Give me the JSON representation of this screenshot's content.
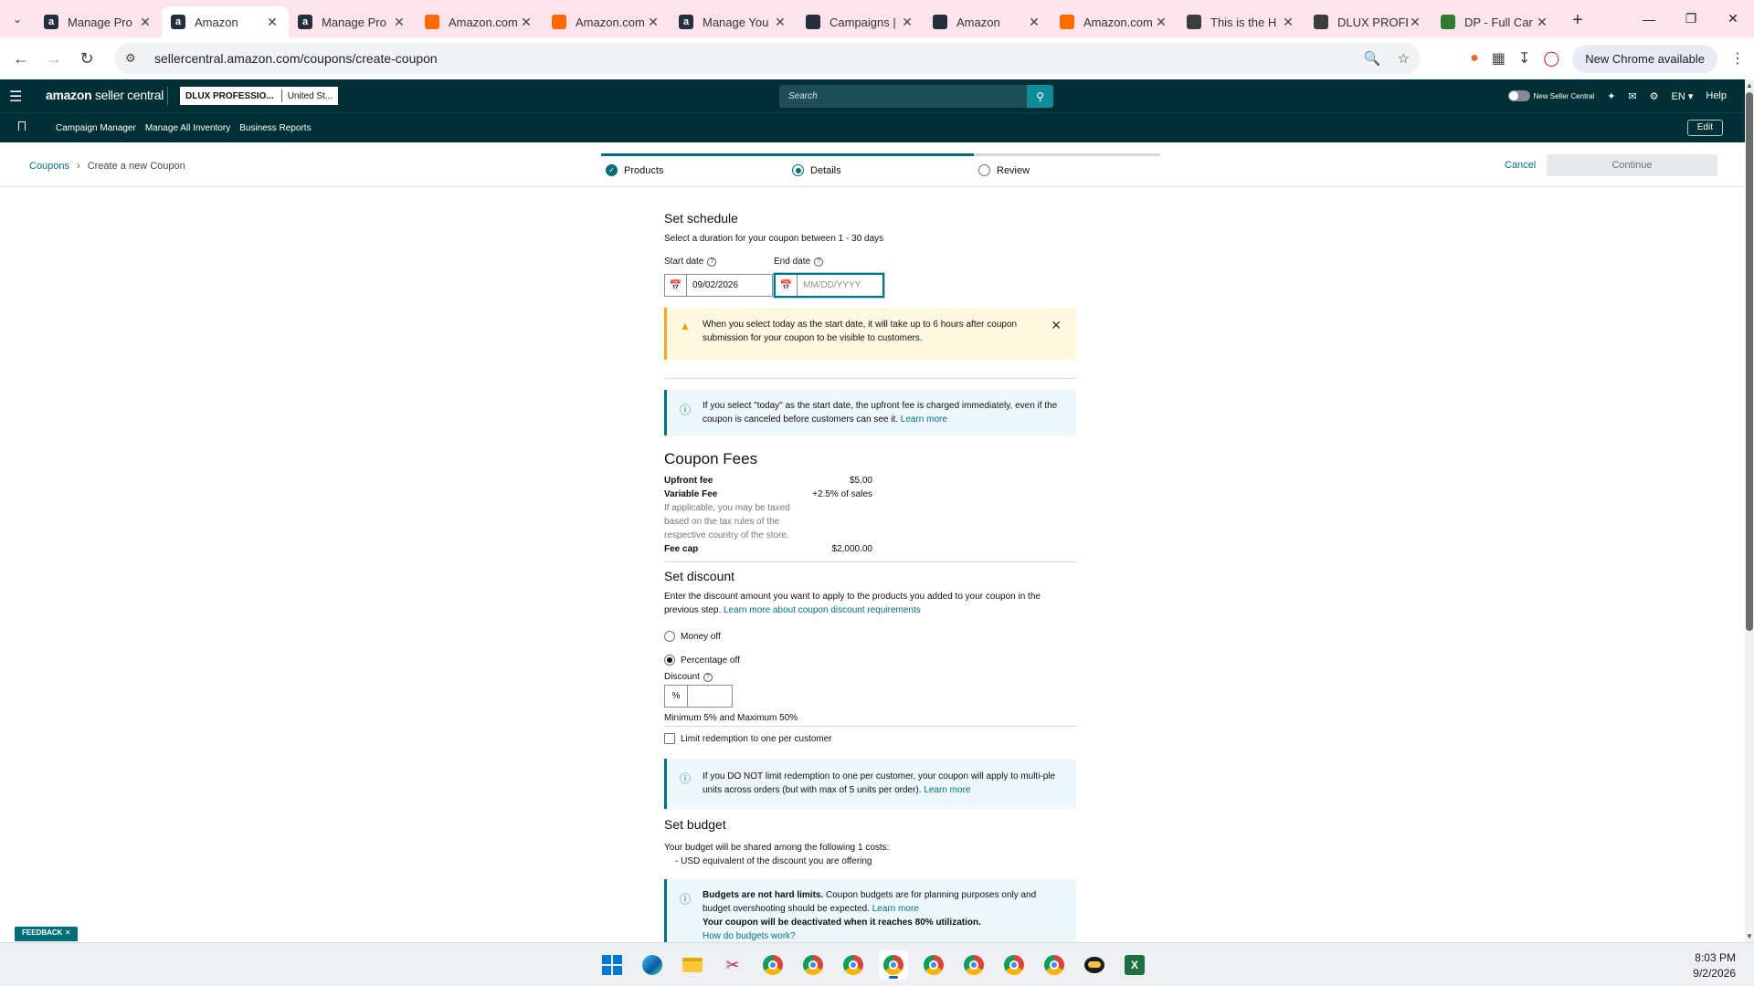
{
  "browser": {
    "tabs": [
      {
        "label": "Manage Pro",
        "favicon": "amazon-a-icon",
        "active": false
      },
      {
        "label": "Amazon",
        "favicon": "amazon-a-icon",
        "active": true
      },
      {
        "label": "Manage Pro",
        "favicon": "amazon-a-icon",
        "active": false
      },
      {
        "label": "Amazon.com",
        "favicon": "amazon-orange-icon",
        "active": false
      },
      {
        "label": "Amazon.com",
        "favicon": "amazon-orange-icon",
        "active": false
      },
      {
        "label": "Manage You",
        "favicon": "amazon-a-icon",
        "active": false
      },
      {
        "label": "Campaigns |",
        "favicon": "amazon-ads-icon",
        "active": false
      },
      {
        "label": "Amazon",
        "favicon": "amazon-ads-icon",
        "active": false
      },
      {
        "label": "Amazon.com",
        "favicon": "amazon-orange-icon",
        "active": false
      },
      {
        "label": "This is the H",
        "favicon": "circle-icon",
        "active": false
      },
      {
        "label": "DLUX PROFE",
        "favicon": "circle-icon",
        "active": false
      },
      {
        "label": "DP - Full Car",
        "favicon": "green-icon",
        "active": false
      }
    ],
    "url": "sellercentral.amazon.com/coupons/create-coupon",
    "new_chrome_label": "New Chrome available"
  },
  "seller_central": {
    "logo_bold": "amazon",
    "logo_rest": " seller central",
    "store_name": "DLUX PROFESSIO...",
    "store_country": "United St...",
    "search_placeholder": "Search",
    "new_seller_central": "New Seller Central",
    "language": "EN",
    "help": "Help",
    "nav_items": [
      "Campaign Manager",
      "Manage All Inventory",
      "Business Reports"
    ],
    "edit_label": "Edit"
  },
  "subheader": {
    "breadcrumb_root": "Coupons",
    "breadcrumb_current": "Create a new Coupon",
    "steps": [
      "Products",
      "Details",
      "Review"
    ],
    "cancel": "Cancel",
    "continue": "Continue"
  },
  "schedule": {
    "title": "Set schedule",
    "desc": "Select a duration for your coupon between 1 - 30 days",
    "start_label": "Start date",
    "end_label": "End date",
    "start_value": "09/02/2026",
    "end_placeholder": "MM/DD/YYYY",
    "warning": "When you select today as the start date, it will take up to 6 hours after coupon submission for your coupon to be visible to customers.",
    "info_text": "If you select \"today\" as the start date, the upfront fee is charged immediately, even if the coupon is canceled before customers can see it.",
    "learn_more": "Learn more"
  },
  "fees": {
    "title": "Coupon Fees",
    "upfront_label": "Upfront fee",
    "upfront_value": "$5.00",
    "variable_label": "Variable Fee",
    "variable_value": "+2.5% of sales",
    "tax_note": "If applicable, you may be taxed based on the tax rules of the respective country of the store.",
    "cap_label": "Fee cap",
    "cap_value": "$2,000.00"
  },
  "discount": {
    "title": "Set discount",
    "desc": "Enter the discount amount you want to apply to the products you added to your coupon in the previous step.",
    "desc_link": "Learn more about coupon discount requirements",
    "option_money": "Money off",
    "option_percent": "Percentage off",
    "discount_label": "Discount",
    "percent_prefix": "%",
    "range_note": "Minimum 5% and Maximum 50%",
    "limit_label": "Limit redemption to one per customer",
    "limit_info": "If you DO NOT limit redemption to one per customer, your coupon will apply to multi-ple units across orders (but with max of 5 units per order).",
    "learn_more": "Learn more"
  },
  "budget": {
    "title": "Set budget",
    "desc": "Your budget will be shared among the following 1 costs:",
    "item": "- USD equivalent of the discount you are offering",
    "info_bold": "Budgets are not hard limits.",
    "info_text": " Coupon budgets are for planning purposes only and budget overshooting should be expected.",
    "learn_more": "Learn more",
    "deactivate": "Your coupon will be deactivated when it reaches 80% utilization.",
    "how_link": "How do budgets work?"
  },
  "feedback": "FEEDBACK",
  "taskbar": {
    "time": "8:03 PM",
    "date": "9/2/2026"
  }
}
